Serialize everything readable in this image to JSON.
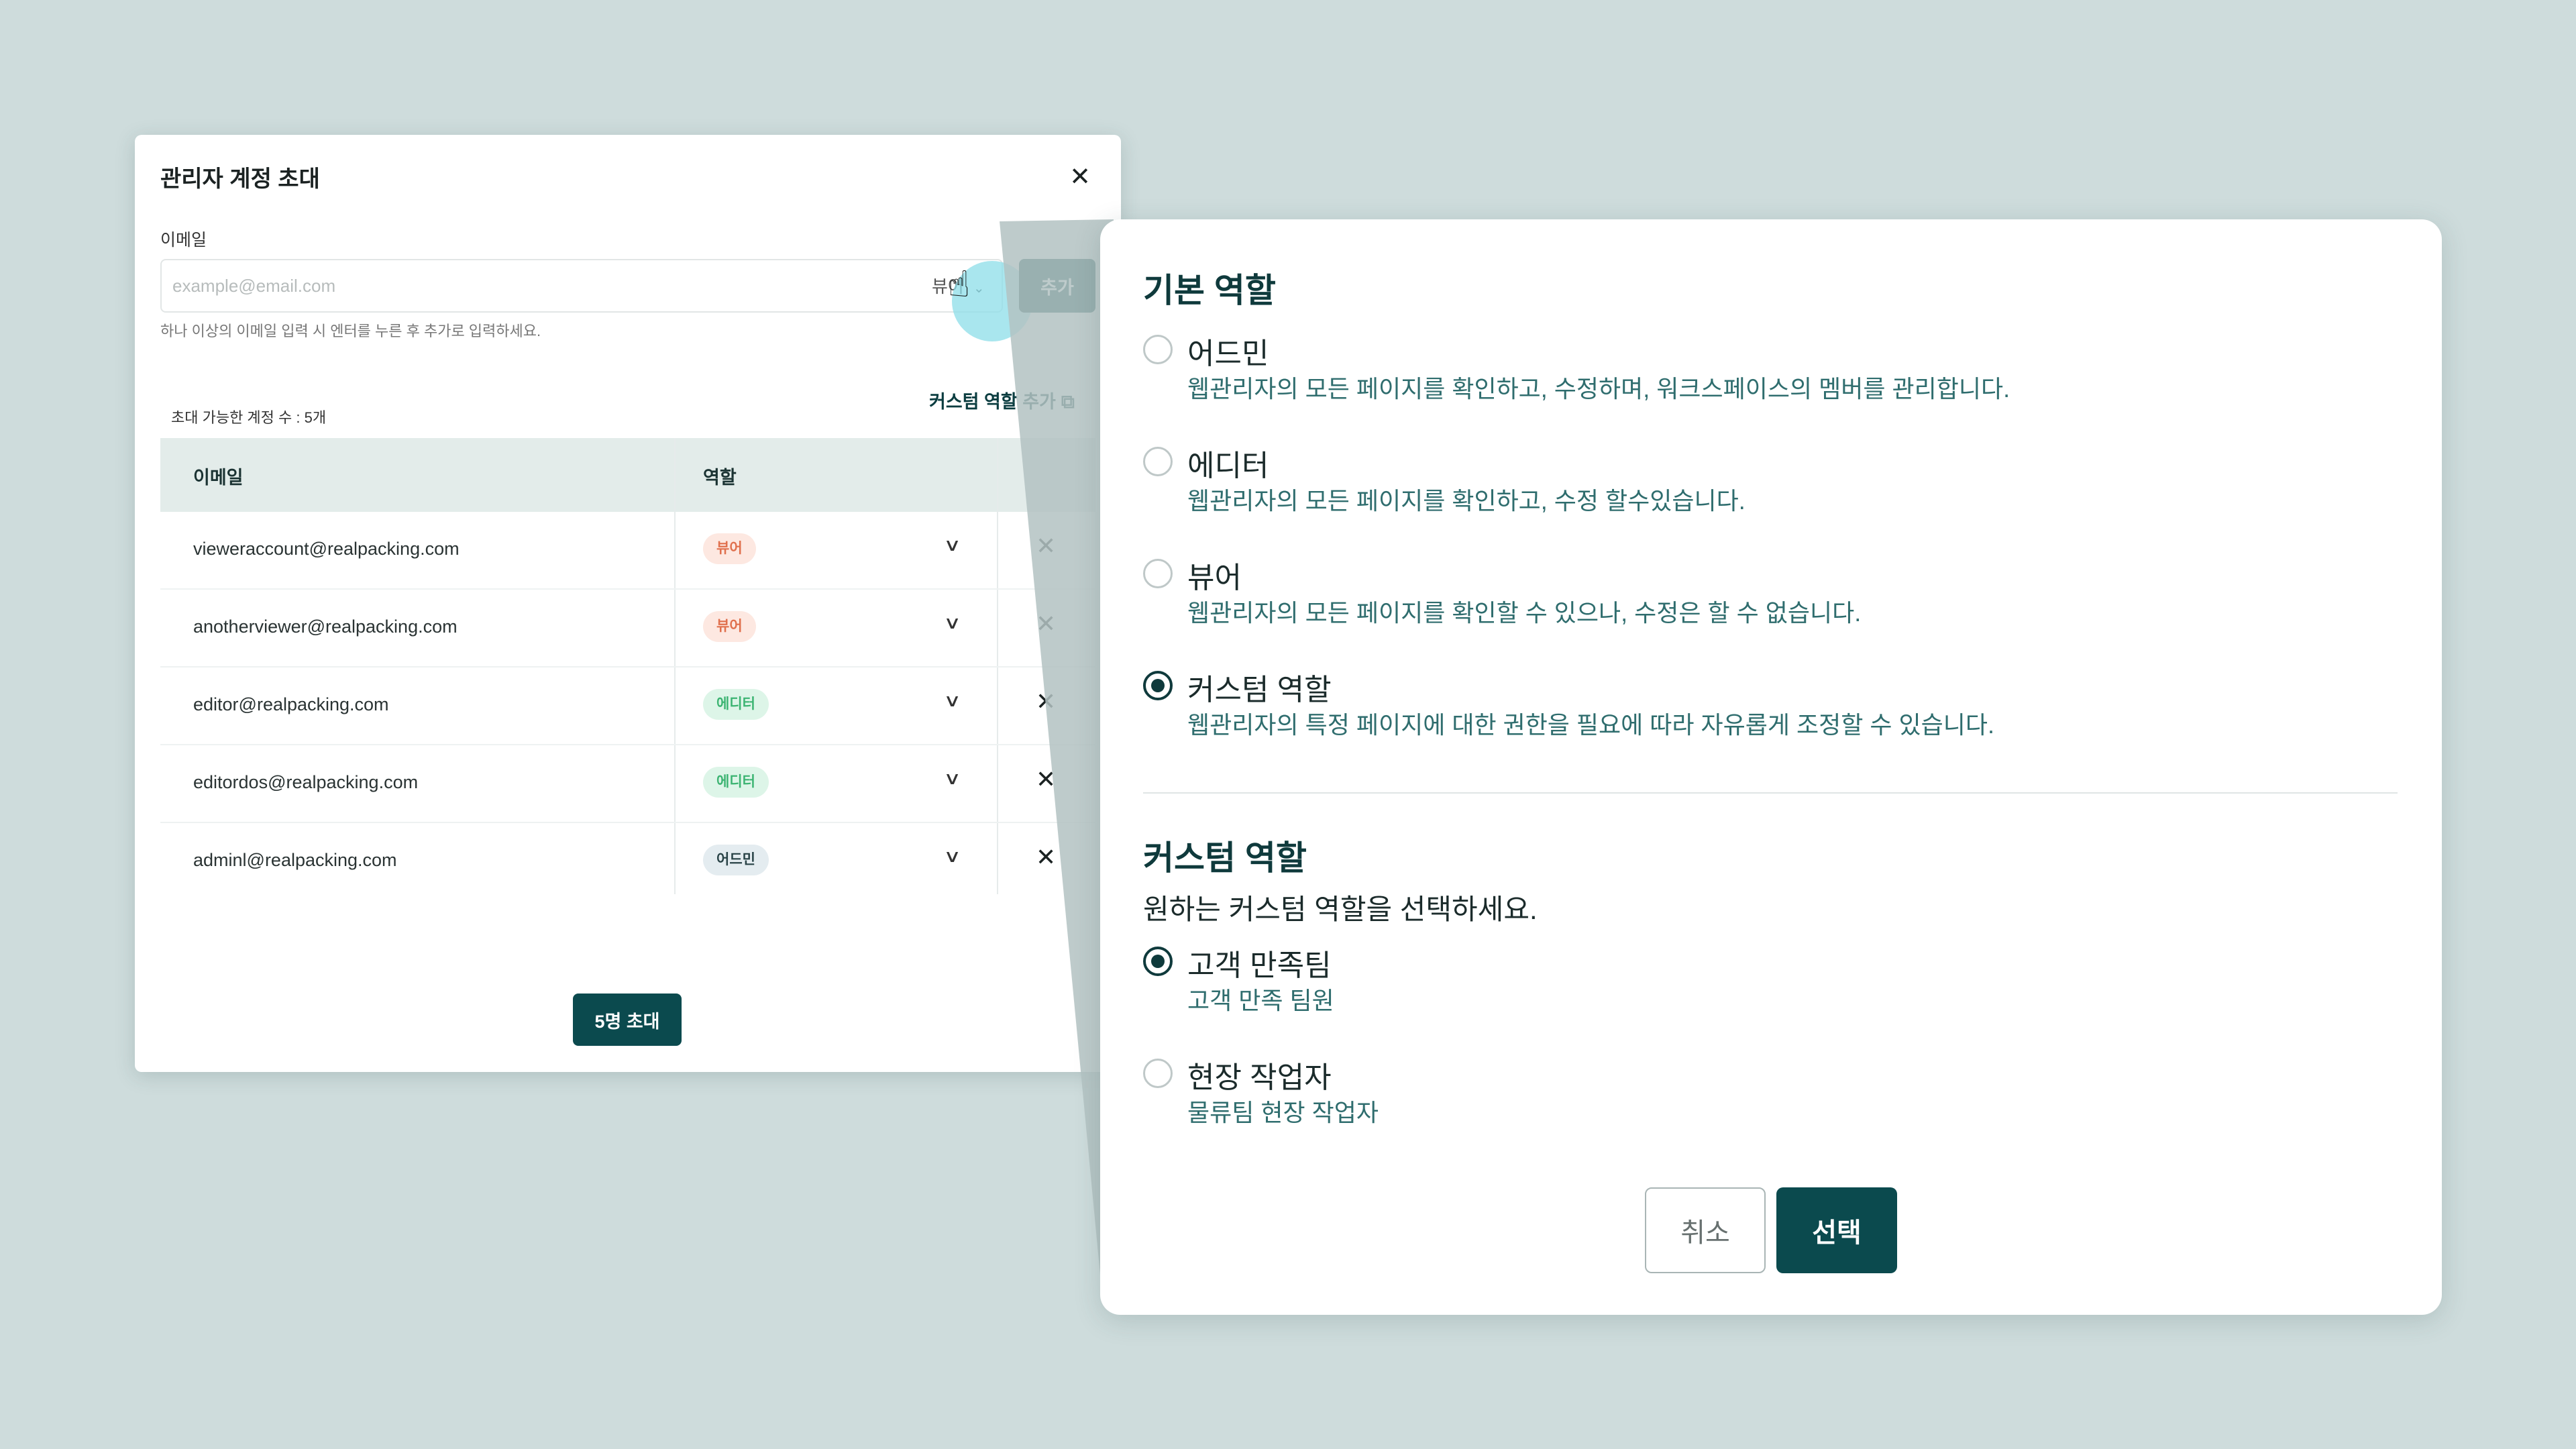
{
  "invite_dialog": {
    "title": "관리자 계정 초대",
    "close_icon": "close-icon",
    "email_label": "이메일",
    "email_placeholder": "example@email.com",
    "role_select_value": "뷰어",
    "add_label": "추가",
    "hint": "하나 이상의 이메일 입력 시 엔터를 누른 후 추가로 입력하세요.",
    "available_count": "초대 가능한 계정 수 : 5개",
    "custom_role_link": "커스텀 역할 추가",
    "table_headers": {
      "email": "이메일",
      "role": "역할"
    },
    "rows": [
      {
        "email": "vieweraccount@realpacking.com",
        "role": "뷰어"
      },
      {
        "email": "anotherviewer@realpacking.com",
        "role": "뷰어"
      },
      {
        "email": "editor@realpacking.com",
        "role": "에디터"
      },
      {
        "email": "editordos@realpacking.com",
        "role": "에디터"
      },
      {
        "email": "adminl@realpacking.com",
        "role": "어드민"
      }
    ],
    "invite_button": "5명 초대"
  },
  "role_panel": {
    "basic_heading": "기본 역할",
    "basic_options": [
      {
        "title": "어드민",
        "desc": "웹관리자의 모든 페이지를 확인하고, 수정하며, 워크스페이스의 멤버를 관리합니다.",
        "selected": false
      },
      {
        "title": "에디터",
        "desc": "웹관리자의 모든 페이지를 확인하고, 수정 할수있습니다.",
        "selected": false
      },
      {
        "title": "뷰어",
        "desc": "웹관리자의 모든 페이지를 확인할 수 있으나, 수정은 할 수 없습니다.",
        "selected": false
      },
      {
        "title": "커스텀 역할",
        "desc": "웹관리자의 특정 페이지에 대한 권한을 필요에 따라 자유롭게 조정할 수 있습니다.",
        "selected": true
      }
    ],
    "custom_heading": "커스텀 역할",
    "custom_subtitle": "원하는 커스텀 역할을 선택하세요.",
    "custom_options": [
      {
        "title": "고객 만족팀",
        "desc": "고객 만족 팀원",
        "selected": true
      },
      {
        "title": "현장 작업자",
        "desc": "물류팀 현장 작업자",
        "selected": false
      }
    ],
    "cancel_label": "취소",
    "select_label": "선택"
  },
  "colors": {
    "background": "#cedcdc",
    "primary": "#0b4a4e",
    "viewer_badge": "#e0704d",
    "editor_badge": "#3cb472",
    "admin_badge": "#284246",
    "cursor_highlight": "#8cdee8"
  }
}
